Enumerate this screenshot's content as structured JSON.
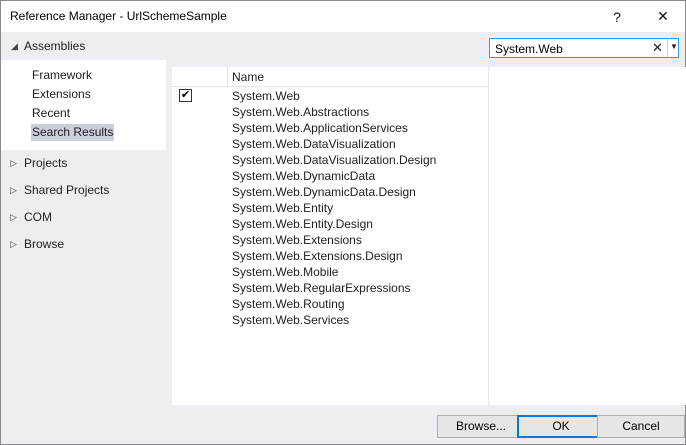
{
  "window": {
    "title": "Reference Manager - UrlSchemeSample",
    "help_glyph": "?",
    "close_glyph": "✕"
  },
  "sections": {
    "assemblies": "Assemblies",
    "projects": "Projects",
    "shared_projects": "Shared Projects",
    "com": "COM",
    "browse": "Browse"
  },
  "assemblies_items": [
    "Framework",
    "Extensions",
    "Recent",
    "Search Results"
  ],
  "selected_item": "Search Results",
  "search": {
    "value": "System.Web",
    "clear_glyph": "✕",
    "dropdown_glyph": "▼"
  },
  "table": {
    "name_header": "Name",
    "rows": [
      {
        "name": "System.Web",
        "checked": true
      },
      {
        "name": "System.Web.Abstractions",
        "checked": false
      },
      {
        "name": "System.Web.ApplicationServices",
        "checked": false
      },
      {
        "name": "System.Web.DataVisualization",
        "checked": false
      },
      {
        "name": "System.Web.DataVisualization.Design",
        "checked": false
      },
      {
        "name": "System.Web.DynamicData",
        "checked": false
      },
      {
        "name": "System.Web.DynamicData.Design",
        "checked": false
      },
      {
        "name": "System.Web.Entity",
        "checked": false
      },
      {
        "name": "System.Web.Entity.Design",
        "checked": false
      },
      {
        "name": "System.Web.Extensions",
        "checked": false
      },
      {
        "name": "System.Web.Extensions.Design",
        "checked": false
      },
      {
        "name": "System.Web.Mobile",
        "checked": false
      },
      {
        "name": "System.Web.RegularExpressions",
        "checked": false
      },
      {
        "name": "System.Web.Routing",
        "checked": false
      },
      {
        "name": "System.Web.Services",
        "checked": false
      }
    ]
  },
  "buttons": {
    "browse": "Browse...",
    "ok": "OK",
    "cancel": "Cancel"
  },
  "icons": {
    "expanded": "expanded-triangle-icon",
    "collapsed": "collapsed-triangle-icon"
  },
  "colors": {
    "accent": "#0078d7",
    "selection": "#cccedb",
    "dialog_bg": "#eeeef2"
  }
}
